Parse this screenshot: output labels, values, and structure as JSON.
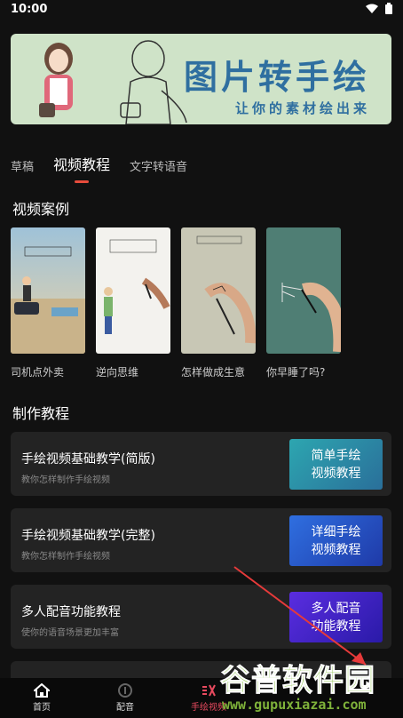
{
  "status_bar": {
    "time": "10:00"
  },
  "banner": {
    "title": "图片转手绘",
    "tagline": "让你的素材绘出来"
  },
  "tabs": [
    {
      "label": "草稿"
    },
    {
      "label": "视频教程"
    },
    {
      "label": "文字转语音"
    }
  ],
  "cases": {
    "section_title": "视频案例",
    "items": [
      {
        "label": "司机点外卖"
      },
      {
        "label": "逆向思维"
      },
      {
        "label": "怎样做成生意"
      },
      {
        "label": "你早睡了吗?"
      }
    ]
  },
  "tutorials": {
    "section_title": "制作教程",
    "items": [
      {
        "title": "手绘视频基础教学(简版)",
        "subtitle": "教你怎样制作手绘视频",
        "button": "简单手绘\n视频教程",
        "color": "#2a8fa5"
      },
      {
        "title": "手绘视频基础教学(完整)",
        "subtitle": "教你怎样制作手绘视频",
        "button": "详细手绘\n视频教程",
        "color": "#2a5cc7"
      },
      {
        "title": "多人配音功能教程",
        "subtitle": "使你的语音场景更加丰富",
        "button": "多人配音\n功能教程",
        "color": "#4a2ad0"
      }
    ]
  },
  "bottom_nav": {
    "items": [
      {
        "label": "首页",
        "icon": "home-icon"
      },
      {
        "label": "配音",
        "icon": "voice-icon"
      },
      {
        "label": "手绘视频",
        "icon": "hand-drawn-video-icon"
      }
    ]
  },
  "watermark": {
    "text": "谷普软件园",
    "url": "www.gupuxiazai.com"
  },
  "colors": {
    "accent": "#e84a5f",
    "background": "#111111",
    "card": "#232323"
  }
}
